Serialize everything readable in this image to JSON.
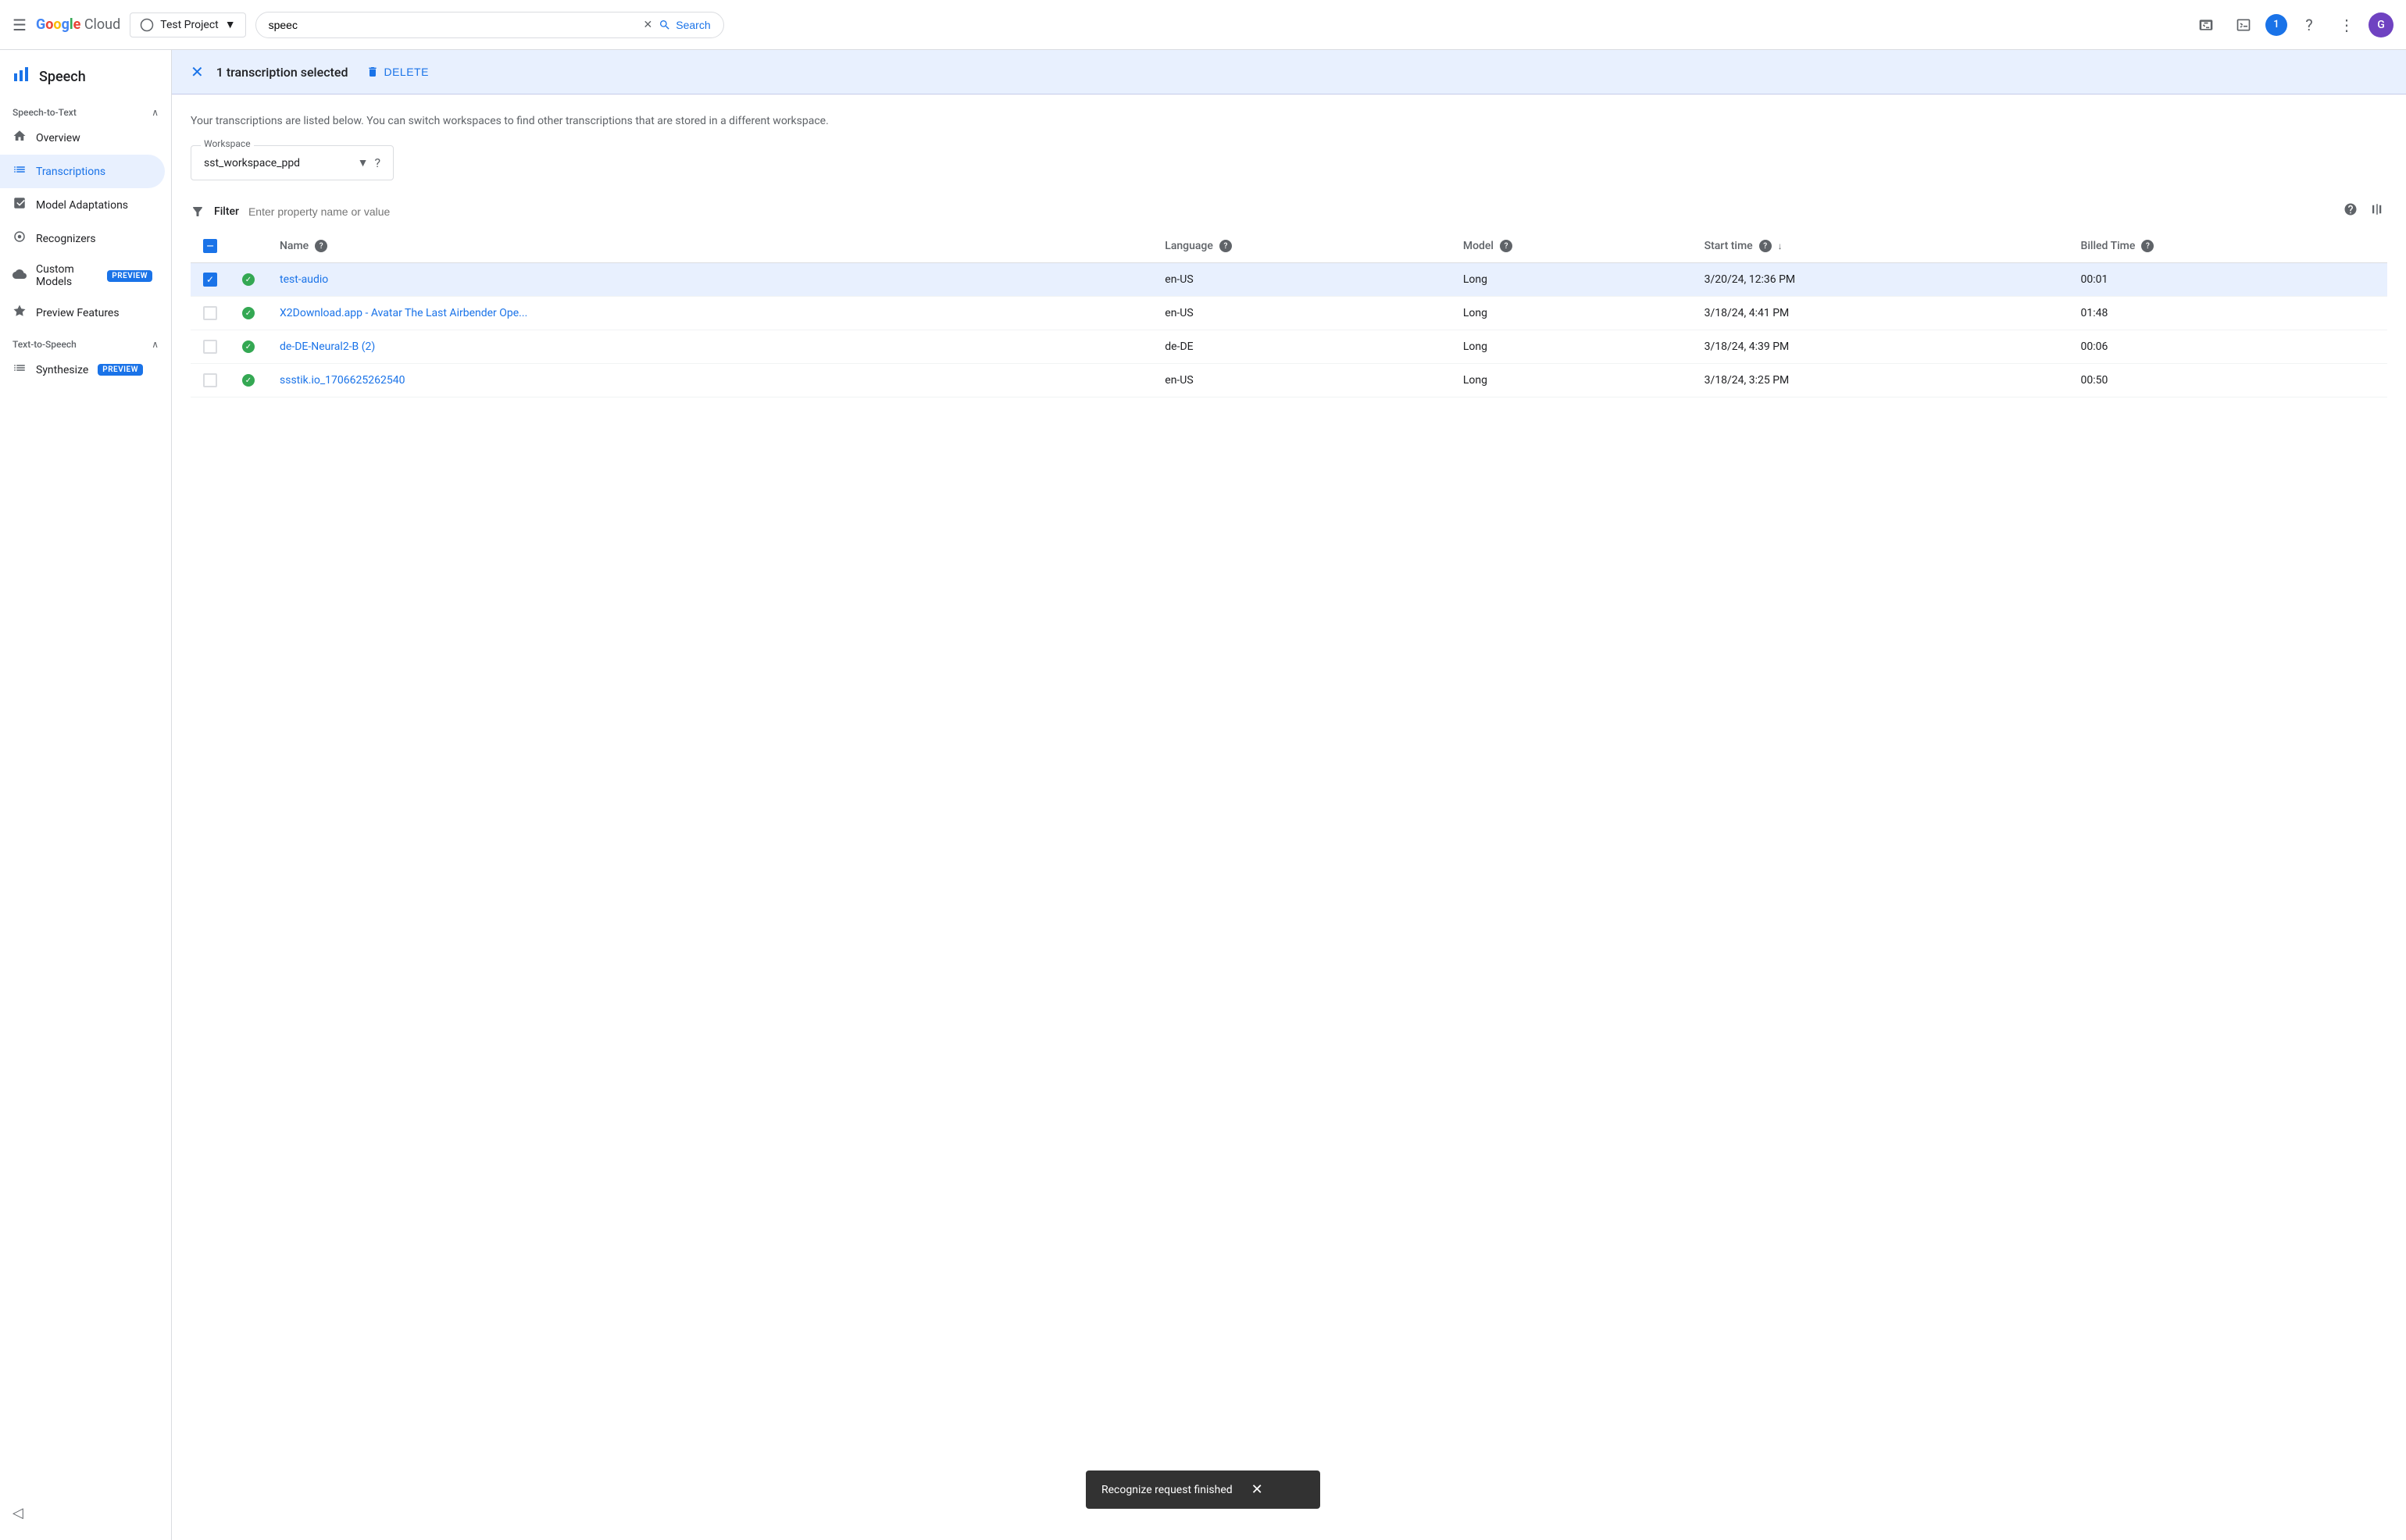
{
  "topNav": {
    "menuIcon": "☰",
    "logoText": "Google Cloud",
    "projectSelector": {
      "label": "Test Project",
      "icon": "▼"
    },
    "search": {
      "value": "speec",
      "placeholder": "Search",
      "clearIcon": "✕",
      "buttonLabel": "Search"
    },
    "icons": {
      "notifications": "🔔",
      "cloudShell": "⊡",
      "notificationCount": "1",
      "help": "?",
      "more": "⋮",
      "avatar": "G"
    }
  },
  "sidebar": {
    "product": {
      "name": "Speech",
      "icon": "📊"
    },
    "sections": [
      {
        "label": "Speech-to-Text",
        "items": [
          {
            "id": "overview",
            "label": "Overview",
            "icon": "⌂",
            "active": false
          },
          {
            "id": "transcriptions",
            "label": "Transcriptions",
            "icon": "≡",
            "active": true
          },
          {
            "id": "model-adaptations",
            "label": "Model Adaptations",
            "icon": "📈",
            "active": false
          },
          {
            "id": "recognizers",
            "label": "Recognizers",
            "icon": "◎",
            "active": false
          },
          {
            "id": "custom-models",
            "label": "Custom Models",
            "icon": "☁",
            "active": false,
            "badge": "PREVIEW"
          },
          {
            "id": "preview-features",
            "label": "Preview Features",
            "icon": "⭐",
            "active": false
          }
        ]
      },
      {
        "label": "Text-to-Speech",
        "items": [
          {
            "id": "synthesize",
            "label": "Synthesize",
            "icon": "≡",
            "active": false,
            "badge": "PREVIEW"
          }
        ]
      }
    ],
    "collapseIcon": "◁"
  },
  "selectionBar": {
    "closeIcon": "✕",
    "text": "1 transcription selected",
    "deleteIcon": "🗑",
    "deleteLabel": "DELETE"
  },
  "content": {
    "description": "Your transcriptions are listed below. You can switch workspaces to find other transcriptions that are stored in a different workspace.",
    "workspace": {
      "label": "Workspace",
      "value": "sst_workspace_ppd",
      "chevron": "▼",
      "helpIcon": "?"
    },
    "filter": {
      "icon": "⚙",
      "label": "Filter",
      "placeholder": "Enter property name or value"
    },
    "tableActions": {
      "helpIcon": "?",
      "columnsIcon": "⊞"
    },
    "tableHeaders": [
      {
        "id": "check",
        "label": "",
        "type": "check"
      },
      {
        "id": "status",
        "label": "",
        "type": "status"
      },
      {
        "id": "name",
        "label": "Name",
        "helpIcon": true
      },
      {
        "id": "language",
        "label": "Language",
        "helpIcon": true
      },
      {
        "id": "model",
        "label": "Model",
        "helpIcon": true
      },
      {
        "id": "start-time",
        "label": "Start time",
        "helpIcon": true,
        "sortIcon": "↓"
      },
      {
        "id": "billed-time",
        "label": "Billed Time",
        "helpIcon": true
      }
    ],
    "rows": [
      {
        "id": "row-1",
        "selected": true,
        "status": "success",
        "name": "test-audio",
        "language": "en-US",
        "model": "Long",
        "startTime": "3/20/24, 12:36 PM",
        "billedTime": "00:01"
      },
      {
        "id": "row-2",
        "selected": false,
        "status": "success",
        "name": "X2Download.app - Avatar The Last Airbender Ope...",
        "language": "en-US",
        "model": "Long",
        "startTime": "3/18/24, 4:41 PM",
        "billedTime": "01:48"
      },
      {
        "id": "row-3",
        "selected": false,
        "status": "success",
        "name": "de-DE-Neural2-B (2)",
        "language": "de-DE",
        "model": "Long",
        "startTime": "3/18/24, 4:39 PM",
        "billedTime": "00:06"
      },
      {
        "id": "row-4",
        "selected": false,
        "status": "success",
        "name": "ssstik.io_1706625262540",
        "language": "en-US",
        "model": "Long",
        "startTime": "3/18/24, 3:25 PM",
        "billedTime": "00:50"
      }
    ]
  },
  "snackbar": {
    "message": "Recognize request finished",
    "closeIcon": "✕"
  }
}
